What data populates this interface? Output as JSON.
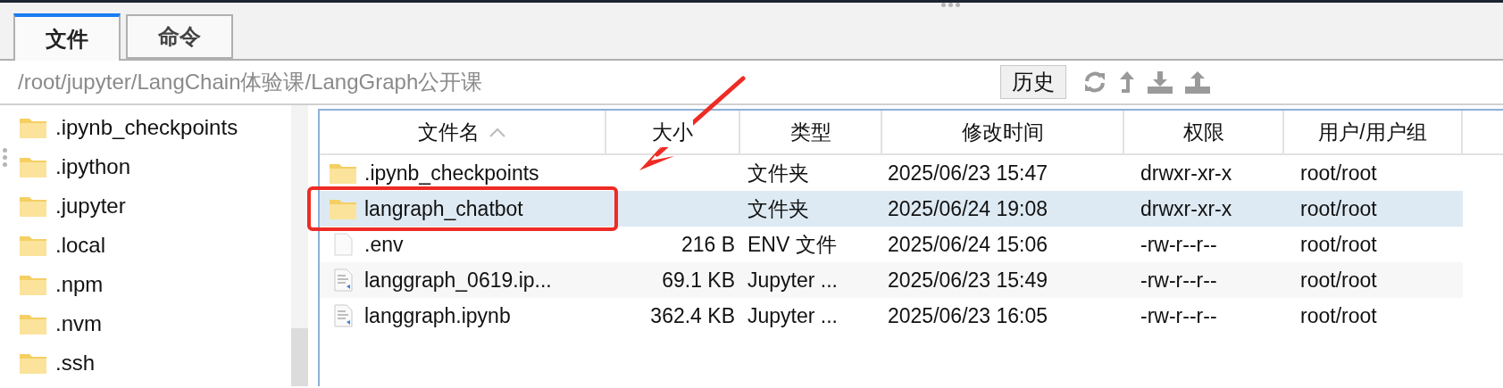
{
  "tabs": [
    {
      "label": "文件",
      "selected": true
    },
    {
      "label": "命令",
      "selected": false
    }
  ],
  "path": "/root/jupyter/LangChain体验课/LangGraph公开课",
  "history_button": "历史",
  "tree": {
    "items": [
      {
        "name": ".ipynb_checkpoints"
      },
      {
        "name": ".ipython"
      },
      {
        "name": ".jupyter"
      },
      {
        "name": ".local"
      },
      {
        "name": ".npm"
      },
      {
        "name": ".nvm"
      },
      {
        "name": ".ssh"
      }
    ]
  },
  "table": {
    "columns": [
      {
        "label": "文件名",
        "sorted": true
      },
      {
        "label": "大小",
        "sorted": false
      },
      {
        "label": "类型",
        "sorted": false
      },
      {
        "label": "修改时间",
        "sorted": false
      },
      {
        "label": "权限",
        "sorted": false
      },
      {
        "label": "用户/用户组",
        "sorted": false
      }
    ],
    "rows": [
      {
        "kind": "folder",
        "name": ".ipynb_checkpoints",
        "type": "文件夹",
        "modified": "2025/06/23 15:47",
        "permissions": "drwxr-xr-x",
        "owner": "root/root",
        "selected": false
      },
      {
        "kind": "folder",
        "name": "langraph_chatbot",
        "type": "文件夹",
        "modified": "2025/06/24 19:08",
        "permissions": "drwxr-xr-x",
        "owner": "root/root",
        "selected": true
      },
      {
        "kind": "file",
        "name": ".env",
        "size": "216 B",
        "type": "ENV 文件",
        "modified": "2025/06/24 15:06",
        "permissions": "-rw-r--r--",
        "owner": "root/root",
        "selected": false
      },
      {
        "kind": "notebook",
        "name": "langgraph_0619.ip...",
        "size": "69.1 KB",
        "type": "Jupyter ...",
        "modified": "2025/06/23 15:49",
        "permissions": "-rw-r--r--",
        "owner": "root/root",
        "selected": false
      },
      {
        "kind": "notebook",
        "name": "langgraph.ipynb",
        "size": "362.4 KB",
        "type": "Jupyter ...",
        "modified": "2025/06/23 16:05",
        "permissions": "-rw-r--r--",
        "owner": "root/root",
        "selected": false
      }
    ]
  }
}
